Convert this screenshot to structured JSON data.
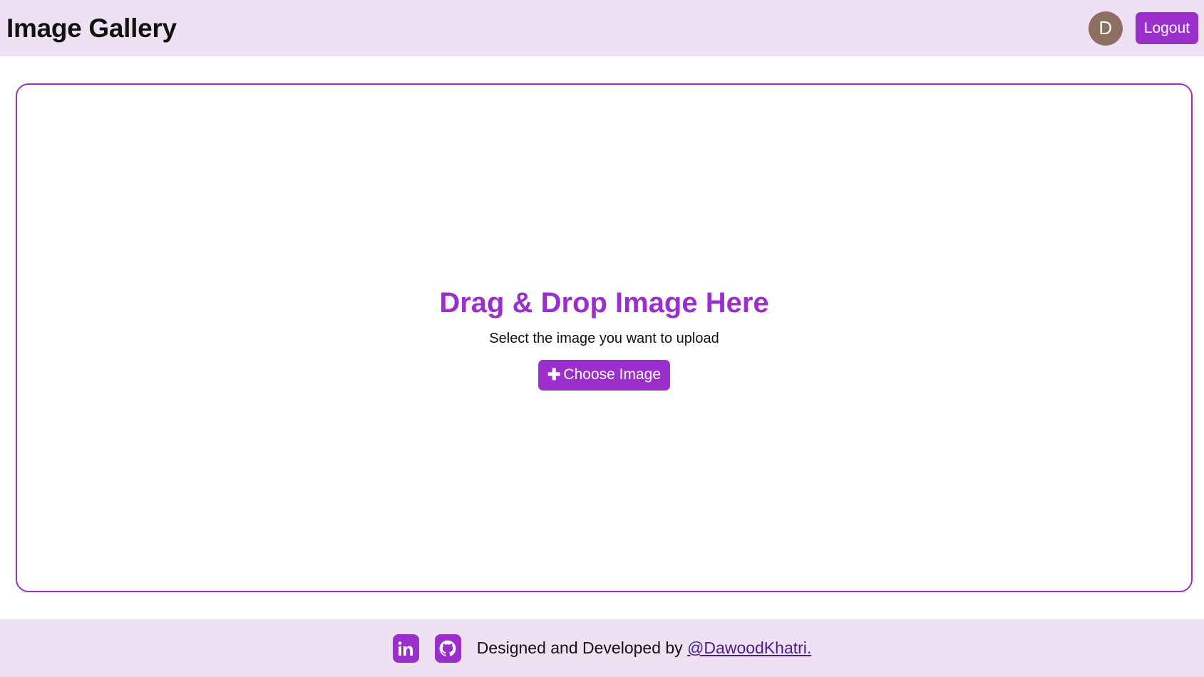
{
  "header": {
    "title": "Image Gallery",
    "avatar_initial": "D",
    "logout_label": "Logout"
  },
  "dropzone": {
    "title": "Drag & Drop Image Here",
    "subtitle": "Select the image you want to upload",
    "choose_label": "Choose Image",
    "choose_icon": "plus-icon"
  },
  "footer": {
    "icons": [
      "linkedin-icon",
      "github-icon"
    ],
    "credit_prefix": "Designed and Developed by",
    "credit_link": "@DawoodKhatri."
  },
  "colors": {
    "accent": "#9b2fcc",
    "header_bg": "#efe1f4",
    "avatar_bg": "#8d6e63",
    "link": "#4a1d8c"
  }
}
